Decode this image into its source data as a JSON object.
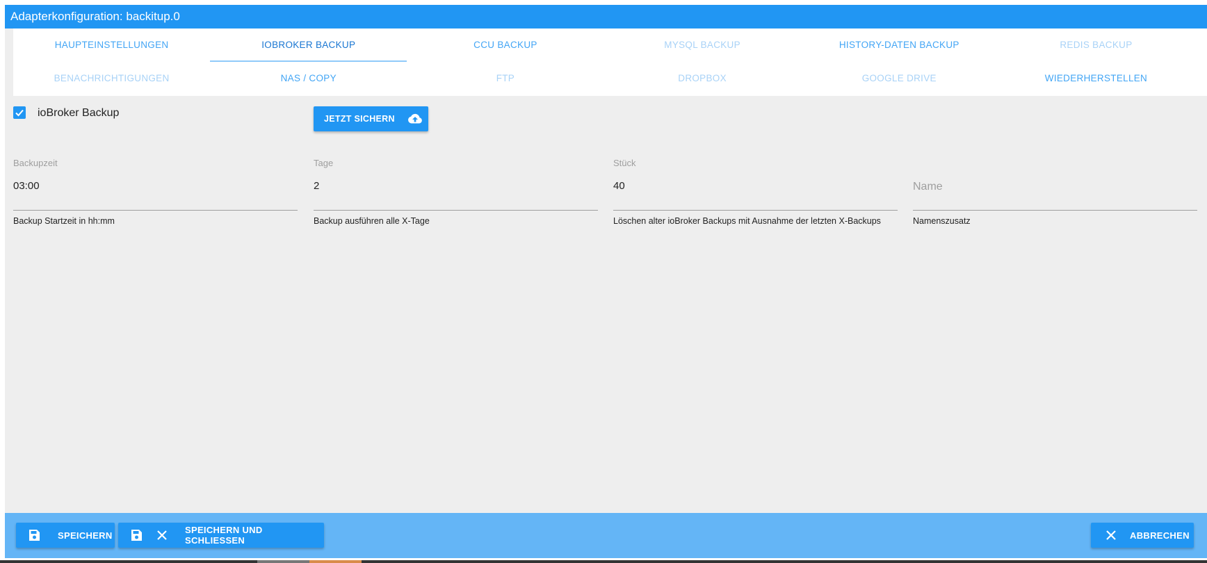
{
  "window": {
    "title": "Adapterkonfiguration: backitup.0"
  },
  "tabs": {
    "row1": [
      {
        "label": "HAUPTEINSTELLUNGEN",
        "state": "normal"
      },
      {
        "label": "IOBROKER BACKUP",
        "state": "active"
      },
      {
        "label": "CCU BACKUP",
        "state": "normal"
      },
      {
        "label": "MYSQL BACKUP",
        "state": "disabled"
      },
      {
        "label": "HISTORY-DATEN BACKUP",
        "state": "normal"
      },
      {
        "label": "REDIS BACKUP",
        "state": "disabled"
      }
    ],
    "row2": [
      {
        "label": "BENACHRICHTIGUNGEN",
        "state": "disabled"
      },
      {
        "label": "NAS / COPY",
        "state": "normal"
      },
      {
        "label": "FTP",
        "state": "disabled"
      },
      {
        "label": "DROPBOX",
        "state": "disabled"
      },
      {
        "label": "GOOGLE DRIVE",
        "state": "disabled"
      },
      {
        "label": "WIEDERHERSTELLEN",
        "state": "normal"
      }
    ]
  },
  "main": {
    "enable_checkbox": {
      "label": "ioBroker Backup",
      "checked": true
    },
    "backup_now_button": {
      "label": "JETZT SICHERN",
      "icon": "cloud-upload-icon"
    },
    "fields": {
      "backupzeit": {
        "label": "Backupzeit",
        "value": "03:00",
        "help": "Backup Startzeit in hh:mm"
      },
      "tage": {
        "label": "Tage",
        "value": "2",
        "help": "Backup ausführen alle X-Tage"
      },
      "stueck": {
        "label": "Stück",
        "value": "40",
        "help": "Löschen alter ioBroker Backups mit Ausnahme der letzten X-Backups"
      },
      "name": {
        "placeholder": "Name",
        "help": "Namenszusatz"
      }
    }
  },
  "footer": {
    "save_label": "SPEICHERN",
    "save_close_label": "SPEICHERN UND SCHLIESSEN",
    "cancel_label": "ABBRECHEN"
  },
  "colors": {
    "primary": "#2196f3",
    "footer_bar": "#64b5f6",
    "background": "#eeeeee",
    "tab_text": "#42a5f5",
    "tab_disabled": "#a8d2f7"
  }
}
